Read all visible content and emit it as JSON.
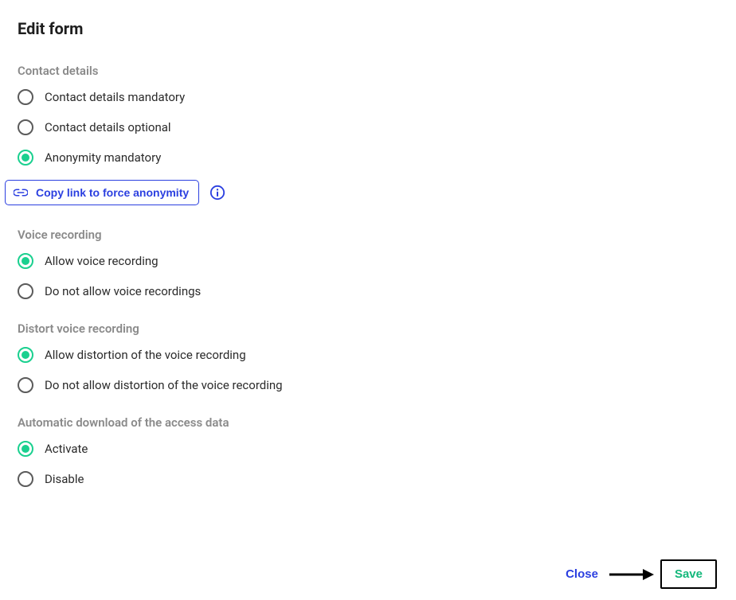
{
  "title": "Edit form",
  "sections": {
    "contact": {
      "heading": "Contact details",
      "opt0": "Contact details mandatory",
      "opt1": "Contact details optional",
      "opt2": "Anonymity mandatory"
    },
    "voice": {
      "heading": "Voice recording",
      "opt0": "Allow voice recording",
      "opt1": "Do not allow voice recordings"
    },
    "distort": {
      "heading": "Distort voice recording",
      "opt0": "Allow distortion of the voice recording",
      "opt1": "Do not allow distortion of the voice recording"
    },
    "autodl": {
      "heading": "Automatic download of the access data",
      "opt0": "Activate",
      "opt1": "Disable"
    }
  },
  "copy_link_label": "Copy link to force anonymity",
  "footer": {
    "close": "Close",
    "save": "Save"
  }
}
